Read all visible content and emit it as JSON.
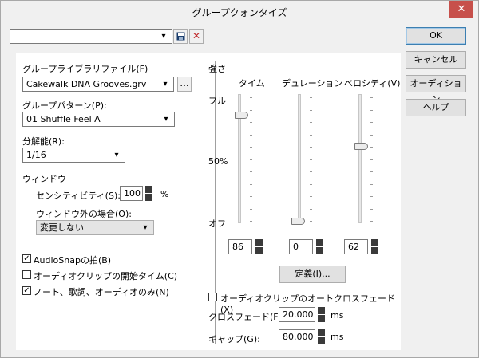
{
  "window": {
    "title": "グループクォンタイズ"
  },
  "presets": {
    "value": "",
    "save_icon": "save-icon",
    "delete_icon": "delete-icon"
  },
  "buttons": {
    "ok": "OK",
    "cancel": "キャンセル",
    "audition": "オーディション",
    "help": "ヘルプ",
    "define": "定義(I)..."
  },
  "left": {
    "library_label": "グループライブラリファイル(F)",
    "library_value": "Cakewalk DNA Grooves.grv",
    "browse": "...",
    "pattern_label": "グループパターン(P):",
    "pattern_value": "01 Shuffle Feel A",
    "resolution_label": "分解能(R):",
    "resolution_value": "1/16",
    "window_label": "ウィンドウ",
    "sensitivity_label": "センシティビティ(S):",
    "sensitivity_value": "100",
    "sensitivity_unit": "%",
    "outside_label": "ウィンドウ外の場合(O):",
    "outside_value": "変更しない",
    "cb_audiosnap": "AudioSnapの拍(B)",
    "cb_clipstart": "オーディオクリップの開始タイム(C)",
    "cb_notes": "ノート、歌詞、オーディオのみ(N)",
    "cb_audiosnap_checked": true,
    "cb_clipstart_checked": false,
    "cb_notes_checked": true
  },
  "strength": {
    "label": "強さ",
    "full": "フル",
    "half": "50%",
    "off": "オフ",
    "timing_label": "タイム",
    "duration_label": "デュレーション",
    "velocity_label": "ベロシティ(V)",
    "timing_value": "86",
    "duration_value": "0",
    "velocity_value": "62"
  },
  "crossfade": {
    "auto_label": "オーディオクリップのオートクロスフェード(X)",
    "auto_checked": false,
    "crossfade_label": "クロスフェード(F):",
    "crossfade_value": "20.000",
    "crossfade_unit": "ms",
    "gap_label": "ギャップ(G):",
    "gap_value": "80.000",
    "gap_unit": "ms"
  }
}
